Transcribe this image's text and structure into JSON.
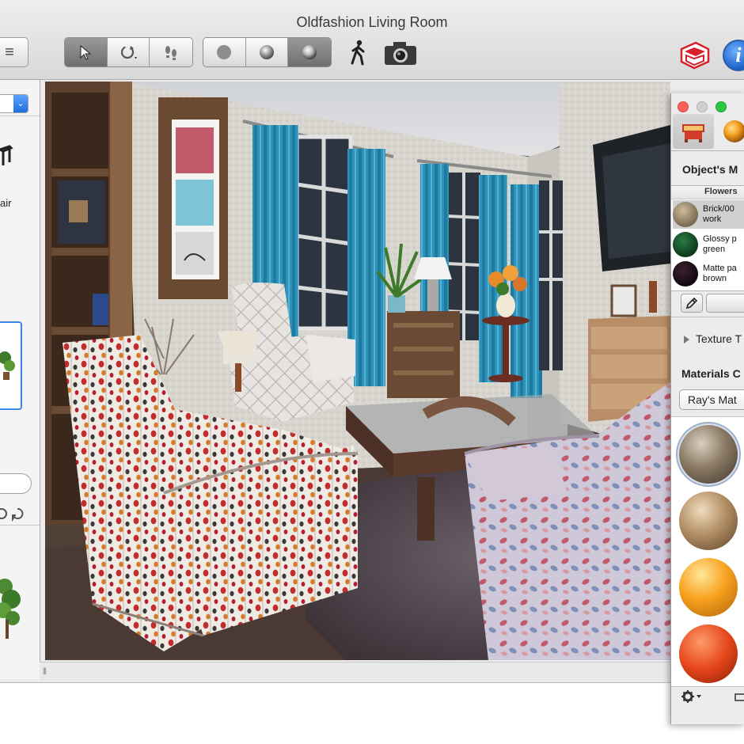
{
  "window": {
    "title": "Oldfashion Living Room"
  },
  "toolbar": {
    "menu_button_label": "≡",
    "tool_group": [
      {
        "name": "select-arrow-icon",
        "active": true
      },
      {
        "name": "rotate-tool-icon",
        "active": false
      },
      {
        "name": "footprints-icon",
        "active": false
      }
    ],
    "view_group": [
      {
        "name": "view-mode-flat-icon",
        "active": false
      },
      {
        "name": "view-mode-shaded-icon",
        "active": false
      },
      {
        "name": "view-mode-rendered-icon",
        "active": true
      }
    ],
    "walk_icon": "walking-person-icon",
    "camera_icon": "camera-icon",
    "info_label": "i"
  },
  "left_panel": {
    "catalog_item_label": "air"
  },
  "palette": {
    "objects_materials_heading": "Object's M",
    "object_group": "Flowers",
    "object_materials": [
      {
        "label": "Brick/00\nwork",
        "color": "#8c7b62"
      },
      {
        "label": "Glossy p\ngreen",
        "color": "#0f4a22"
      },
      {
        "label": "Matte pa\nbrown",
        "color": "#1b0d14"
      }
    ],
    "texture_label": "Texture T",
    "materials_heading": "Materials C",
    "materials_dropdown": "Ray's Mat",
    "material_swatches": [
      {
        "name": "floral-fabric",
        "color": "#7b6a55"
      },
      {
        "name": "tan-fabric",
        "color": "#b39066"
      },
      {
        "name": "orange-glossy",
        "color": "#f59c1a"
      },
      {
        "name": "red-orange-matte",
        "color": "#e5461a"
      }
    ]
  },
  "colors": {
    "accent": "#1b6fd0",
    "curtain": "#2b8fb5",
    "wall": "#d9d6d0",
    "floor": "#4a3a33"
  }
}
